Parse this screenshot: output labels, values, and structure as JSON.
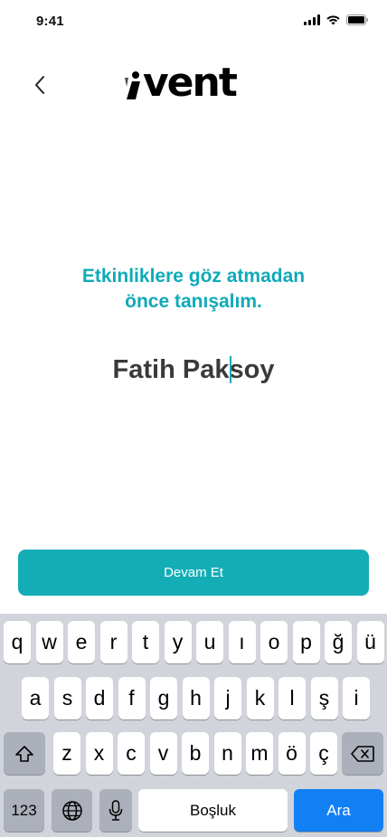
{
  "status_bar": {
    "time": "9:41"
  },
  "header": {
    "logo_text": "vent"
  },
  "prompt": {
    "line1": "Etkinliklere göz atmadan",
    "line2": "önce tanışalım."
  },
  "name_input": {
    "value": "Fatih Paksoy"
  },
  "continue_button": {
    "label": "Devam Et"
  },
  "keyboard": {
    "row1": [
      "q",
      "w",
      "e",
      "r",
      "t",
      "y",
      "u",
      "ı",
      "o",
      "p",
      "ğ",
      "ü"
    ],
    "row2": [
      "a",
      "s",
      "d",
      "f",
      "g",
      "h",
      "j",
      "k",
      "l",
      "ş",
      "i"
    ],
    "row3": [
      "z",
      "x",
      "c",
      "v",
      "b",
      "n",
      "m",
      "ö",
      "ç"
    ],
    "numbers_label": "123",
    "space_label": "Boşluk",
    "search_label": "Ara"
  },
  "colors": {
    "accent": "#10aab8",
    "button": "#14adb6",
    "keyboard_bg": "#d1d4da",
    "search_key": "#137ff5"
  }
}
